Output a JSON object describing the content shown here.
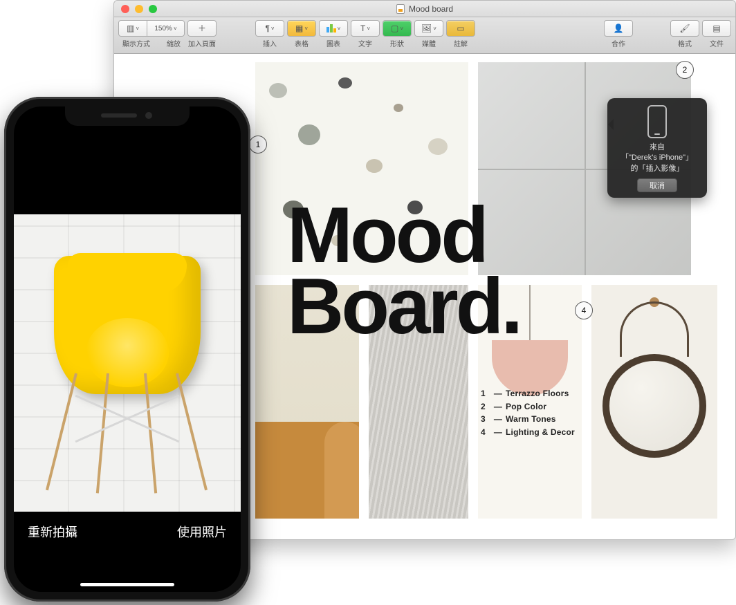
{
  "window": {
    "title": "Mood board",
    "toolbar": {
      "view": {
        "label": "顯示方式",
        "icon": "view-mode-icon"
      },
      "zoom": {
        "label": "縮放",
        "value": "150%"
      },
      "addPage": {
        "label": "加入頁面",
        "glyph": "＋"
      },
      "insert": {
        "label": "插入",
        "glyph": "¶"
      },
      "table": {
        "label": "表格"
      },
      "chart": {
        "label": "圖表"
      },
      "text": {
        "label": "文字",
        "glyph": "T"
      },
      "shape": {
        "label": "形狀"
      },
      "media": {
        "label": "媒體"
      },
      "comment": {
        "label": "註解"
      },
      "collab": {
        "label": "合作"
      },
      "format": {
        "label": "格式"
      },
      "document": {
        "label": "文件"
      }
    }
  },
  "document": {
    "headline": "Mood\nBoard.",
    "legend": [
      {
        "n": "1",
        "text": "Terrazzo Floors"
      },
      {
        "n": "2",
        "text": "Pop Color"
      },
      {
        "n": "3",
        "text": "Warm Tones"
      },
      {
        "n": "4",
        "text": "Lighting & Decor"
      }
    ]
  },
  "popover": {
    "line1": "來自",
    "line2": "「\"Derek's iPhone\"」",
    "line3": "的「插入影像」",
    "cancel": "取消"
  },
  "steps": {
    "s1": "1",
    "s2": "2",
    "s4": "4"
  },
  "iphone": {
    "retake": "重新拍攝",
    "usePhoto": "使用照片"
  }
}
